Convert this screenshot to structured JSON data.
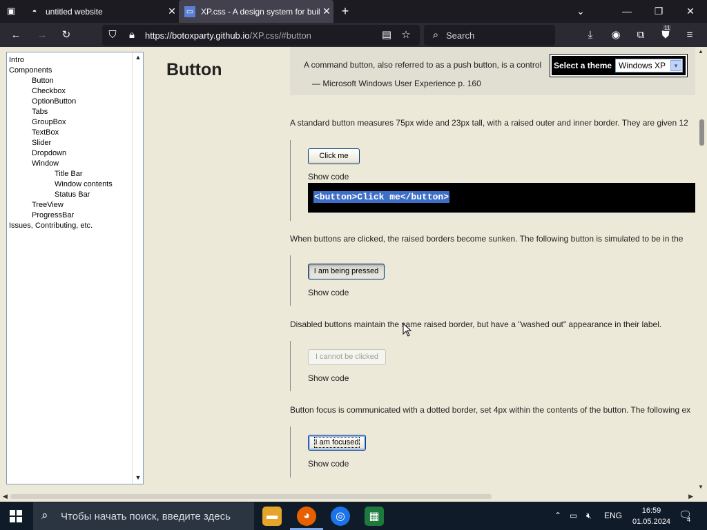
{
  "browser": {
    "tabs": [
      {
        "title": "untitled website",
        "active": false
      },
      {
        "title": "XP.css - A design system for buil",
        "active": true
      }
    ],
    "url_host": "https://botoxparty.github.io",
    "url_rest": "/XP.css/#button",
    "search_placeholder": "Search",
    "extension_badge": "11"
  },
  "sidebar": {
    "items": [
      {
        "label": "Intro",
        "level": 0
      },
      {
        "label": "Components",
        "level": 0
      },
      {
        "label": "Button",
        "level": 1
      },
      {
        "label": "Checkbox",
        "level": 1
      },
      {
        "label": "OptionButton",
        "level": 1
      },
      {
        "label": "Tabs",
        "level": 1
      },
      {
        "label": "GroupBox",
        "level": 1
      },
      {
        "label": "TextBox",
        "level": 1
      },
      {
        "label": "Slider",
        "level": 1
      },
      {
        "label": "Dropdown",
        "level": 1
      },
      {
        "label": "Window",
        "level": 1
      },
      {
        "label": "Title Bar",
        "level": 2
      },
      {
        "label": "Window contents",
        "level": 2
      },
      {
        "label": "Status Bar",
        "level": 2
      },
      {
        "label": "TreeView",
        "level": 1
      },
      {
        "label": "ProgressBar",
        "level": 1
      },
      {
        "label": "Issues, Contributing, etc.",
        "level": 0
      }
    ]
  },
  "page": {
    "heading": "Button",
    "quote_line": "A command button, also referred to as a push button, is a control",
    "quote_source": "— Microsoft Windows User Experience p. 160",
    "theme_label": "Select a theme",
    "theme_value": "Windows XP",
    "para_standard": "A standard button measures 75px wide and 23px tall, with a raised outer and inner border. They are given 12",
    "btn_click": "Click me",
    "show_code": "Show code",
    "code_sample": "<button>Click me</button>",
    "para_pressed": "When buttons are clicked, the raised borders become sunken. The following button is simulated to be in the",
    "btn_pressed": "I am being pressed",
    "para_disabled": "Disabled buttons maintain the same raised border, but have a \"washed out\" appearance in their label.",
    "btn_disabled": "I cannot be clicked",
    "para_focus": "Button focus is communicated with a dotted border, set 4px within the contents of the button. The following ex",
    "btn_focused": "I am focused"
  },
  "taskbar": {
    "search_placeholder": "Чтобы начать поиск, введите здесь",
    "lang": "ENG",
    "time": "16:59",
    "date": "01.05.2024",
    "notifications": "4"
  }
}
